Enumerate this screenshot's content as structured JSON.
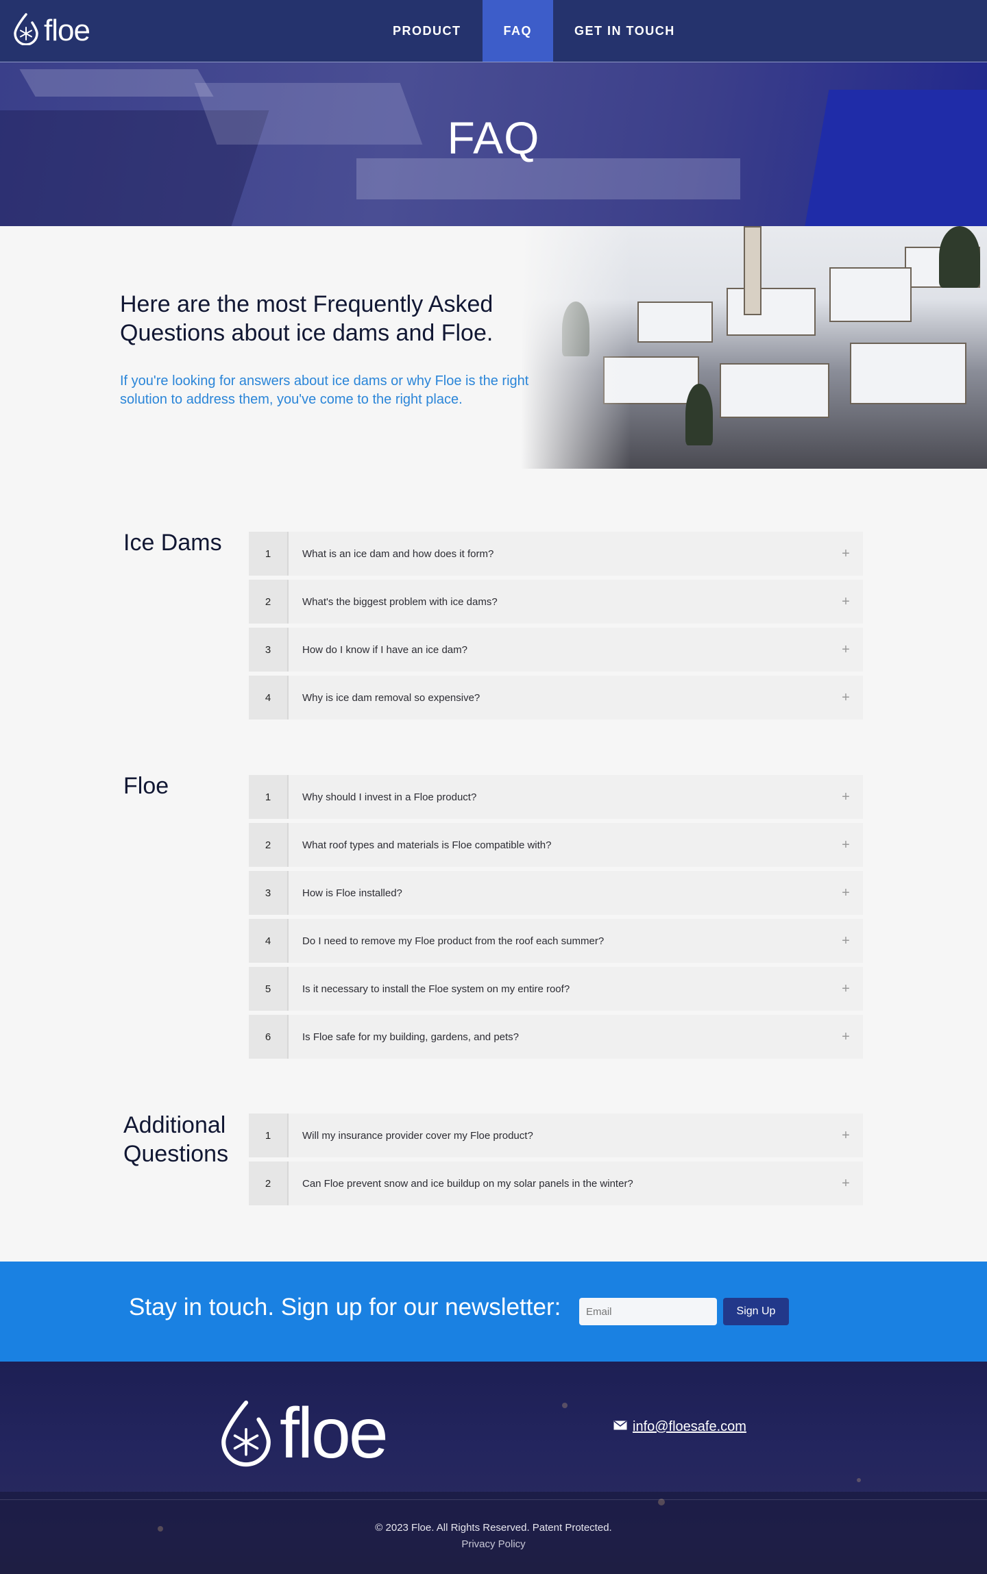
{
  "nav": {
    "brand": "floe",
    "links": [
      {
        "label": "PRODUCT"
      },
      {
        "label": "FAQ"
      },
      {
        "label": "GET IN TOUCH"
      }
    ]
  },
  "hero": {
    "title": "FAQ"
  },
  "intro": {
    "heading": "Here are the most Frequently Asked Questions about ice dams and Floe.",
    "subtext": "If you're looking for answers about ice dams or why Floe is the right solution to address them, you've come to the right place."
  },
  "faq": {
    "sections": [
      {
        "title": "Ice Dams",
        "items": [
          {
            "num": "1",
            "question": "What is an ice dam and how does it form?",
            "toggle": "+"
          },
          {
            "num": "2",
            "question": "What's the biggest problem with ice dams?",
            "toggle": "+"
          },
          {
            "num": "3",
            "question": "How do I know if I have an ice dam?",
            "toggle": "+"
          },
          {
            "num": "4",
            "question": "Why is ice dam removal so expensive?",
            "toggle": "+"
          }
        ]
      },
      {
        "title": "Floe",
        "items": [
          {
            "num": "1",
            "question": "Why should I invest in a Floe product?",
            "toggle": "+"
          },
          {
            "num": "2",
            "question": "What roof types and materials is Floe compatible with?",
            "toggle": "+"
          },
          {
            "num": "3",
            "question": "How is Floe installed?",
            "toggle": "+"
          },
          {
            "num": "4",
            "question": "Do I need to remove my Floe product from the roof each summer?",
            "toggle": "+"
          },
          {
            "num": "5",
            "question": "Is it necessary to install the Floe system on my entire roof?",
            "toggle": "+"
          },
          {
            "num": "6",
            "question": "Is Floe safe for my building, gardens, and pets?",
            "toggle": "+"
          }
        ]
      },
      {
        "title_line1": "Additional",
        "title_line2": "Questions",
        "items": [
          {
            "num": "1",
            "question": "Will my insurance provider cover my Floe product?",
            "toggle": "+"
          },
          {
            "num": "2",
            "question": "Can Floe prevent snow and ice buildup on my solar panels in the winter?",
            "toggle": "+"
          }
        ]
      }
    ]
  },
  "newsletter": {
    "title": "Stay in touch. Sign up for our newsletter:",
    "email_placeholder": "Email",
    "button": "Sign Up"
  },
  "footer": {
    "brand": "floe",
    "email": "info@floesafe.com",
    "copyright": "© 2023 Floe. All Rights Reserved. Patent Protected.",
    "privacy": "Privacy Policy"
  },
  "colors": {
    "nav_bg": "#25336d",
    "nav_active": "#3d5dc9",
    "accent_blue": "#1a81e2",
    "intro_sub": "#2a85d8",
    "button_dark": "#22388a"
  }
}
